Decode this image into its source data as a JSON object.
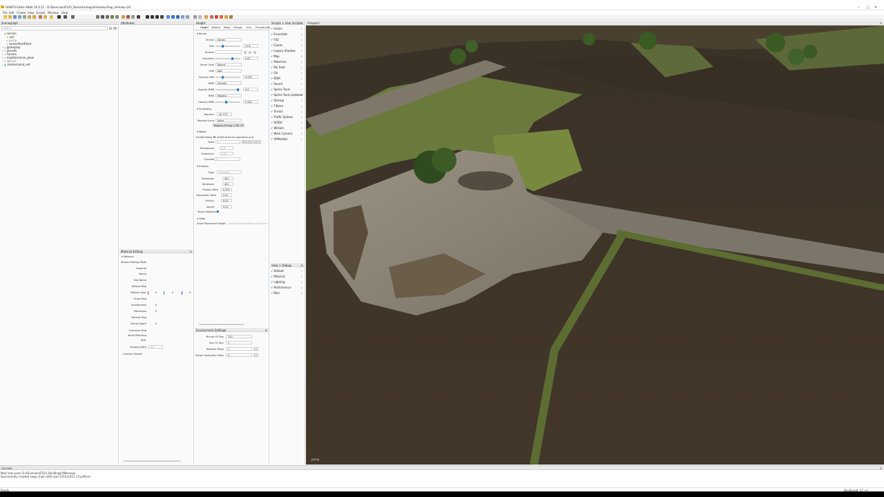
{
  "app": {
    "title": "GIANTS Editor 64bit 10.0.11 - D:/Diversion/FS25_Remarks/maps/mimaku/map_mimaku.i3d",
    "win_min": "–",
    "win_max": "□",
    "win_close": "✕"
  },
  "menu": [
    "File",
    "Edit",
    "Create",
    "View",
    "Scripts",
    "Window",
    "Help"
  ],
  "scenegraph": {
    "title": "Scenegraph",
    "search_placeholder": "Search",
    "items": [
      "terrain",
      "sun",
      "persp",
      "careerStartPoint",
      "gameplay",
      "aiscells",
      "Forests",
      "roadsterrence_plow",
      "splines",
      "markerlcand_set"
    ]
  },
  "attributes": {
    "title": "Attributes"
  },
  "height": {
    "title": "Height",
    "tabs": [
      "Height",
      "Texture",
      "Mask",
      "Foliage",
      "Info",
      "Procedurals"
    ],
    "brush": {
      "section": "Brush",
      "terrain_label": "Terrain",
      "terrain_value": "terrain",
      "size_label": "Size",
      "size_value": "21.8",
      "size_level": 0.3,
      "presets_label": "Presets",
      "hardness_label": "Hardness",
      "hardness_value": "0.67",
      "hardness_level": 0.67,
      "brushtype_label": "Brush Type",
      "brushtype_value": "Round",
      "lmb_label": "LMB",
      "lmb_value": "Add",
      "opacity_lmb_label": "Opacity LMB",
      "opacity_lmb_value": "0.293",
      "opacity_lmb_level": 0.29,
      "mmb_label": "MMB",
      "mmb_value": "Smooth",
      "opacity_mmb_label": "Opacity MMB",
      "opacity_mmb_value": "0.9",
      "opacity_mmb_level": 0.9,
      "rmb_label": "RMB",
      "rmb_value": "Replace",
      "opacity_rmb_label": "Opacity RMB",
      "opacity_rmb_value": "0.432",
      "opacity_rmb_level": 0.43
    },
    "sculpting": {
      "section": "Sculpting",
      "replace_label": "Replace",
      "replace_value": "42.779",
      "replace_limit_label": "Replace Limit",
      "replace_limit_value": "None",
      "replace_picking": "Replace Picking: CTRL+R"
    },
    "noise": {
      "section": "Noise",
      "enable_label": "Enable Noise",
      "addsub_label": "Add/Sub Brush operation only",
      "seed_label": "Seed",
      "seed_value": "0",
      "random_seed": "Random Seed",
      "persistence_label": "Persistence",
      "persistence_value": "0.8",
      "frequency_label": "Frequency",
      "frequency_value": "0.25",
      "octaves_label": "Octaves",
      "octaves_value": "3"
    },
    "erosion": {
      "section": "Erosion",
      "type_label": "Type",
      "type_value": "Hydraulic",
      "raindrops_label": "Raindrops",
      "raindrops_value": "401",
      "iterations_label": "Iterations",
      "iterations_value": "401",
      "erosion_rate_label": "Erosion Rate",
      "erosion_rate_value": "0.101",
      "deposition_rate_label": "Deposition Rate",
      "deposition_rate_value": "0.47",
      "friction_label": "Friction",
      "friction_value": "0.05",
      "speed_label": "Speed",
      "speed_value": "0.01",
      "show_feedback_label": "Show Feedback"
    },
    "view": {
      "section": "View",
      "show_processed_label": "Show Processed Height",
      "show_processed_value": "needs ProceduralPlacement.xml"
    }
  },
  "scripts": {
    "title": "Scripts > User Scripts",
    "items": [
      "Action",
      "Essentials",
      "FS3",
      "Giants",
      "Legacy Shadow",
      "Map",
      "Materials",
      "Mo Tools",
      "Ob",
      "RDM",
      "Sound",
      "Spline Tools",
      "Spline Tools Updated",
      "Startup",
      "T-Bone",
      "Terrain",
      "Traffic Splines",
      "W3Dd",
      "William",
      "Work Camera",
      "XPModder"
    ]
  },
  "viewdebug": {
    "title": "View > Debug",
    "items": [
      "Default",
      "Material",
      "Lighting",
      "Performance",
      "Misc"
    ]
  },
  "viewport": {
    "title": "Viewport",
    "camera_label": "persp"
  },
  "material_editing": {
    "title": "Material Editing",
    "material_header": "Material",
    "shared_mode": "Shared Editing Mode",
    "labels": {
      "material": "Material",
      "name": "Name",
      "slot_name": "Slot Name",
      "diffuse_map": "Diffuse Map",
      "diffuse_color": "Diffuse Color",
      "gloss_map": "Gloss Map",
      "smoothness": "Smoothness",
      "metalness": "Metalness",
      "normal_map": "Normal Map",
      "bump_depth": "Bump Depth",
      "emissive_map": "Emissive Map",
      "alpha_blending": "Alpha Blending",
      "refl": "Refl.",
      "shading_rate": "Shading Rate"
    },
    "diffuse_values": [
      "0",
      "0",
      "0"
    ],
    "smoothness_value": "0",
    "metalness_value": "0",
    "bump_value": "0",
    "shading_rate_value": "1x1",
    "custom_shader": "Custom Shader"
  },
  "environment": {
    "title": "Environment Settings",
    "minute_label": "Minute Of Day",
    "minute_value": "720",
    "day_label": "Day Of Year",
    "day_value": "1",
    "weather_label": "Weather Mask",
    "weather_value": "1",
    "viewer_label": "Viewer Speciality Mask",
    "viewer_value": "4"
  },
  "console": {
    "title": "Console",
    "lines": [
      "Mod root used: D:/Diversion/FS25_BuildingsOfNorway/",
      "Successfully created swap chain with size 2311x1011 (3 buffers)"
    ]
  },
  "status": {
    "left": "Ready",
    "right": "NavSpeed: 17 +/-"
  },
  "colors": {
    "accent": "#2a7dd6",
    "check": "#1a73d9",
    "panel_bg": "#fafafa",
    "header_bg": "#e9e9e9"
  }
}
